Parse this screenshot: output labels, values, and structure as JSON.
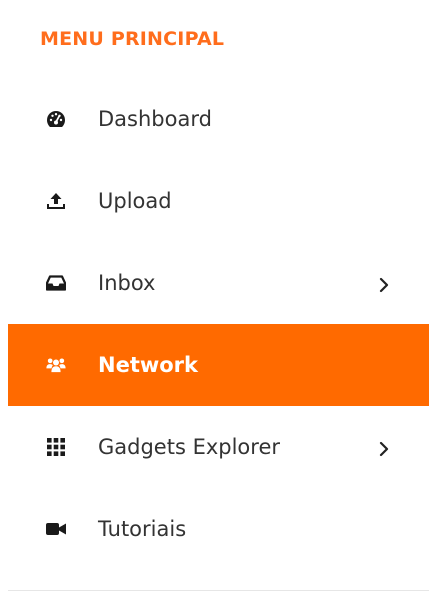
{
  "menu": {
    "title": "MENU PRINCIPAL",
    "active_color": "#ff6a00",
    "title_color": "#ff6d1c",
    "items": [
      {
        "label": "Dashboard",
        "icon": "dashboard-icon",
        "has_submenu": false,
        "active": false
      },
      {
        "label": "Upload",
        "icon": "upload-icon",
        "has_submenu": false,
        "active": false
      },
      {
        "label": "Inbox",
        "icon": "inbox-icon",
        "has_submenu": true,
        "active": false
      },
      {
        "label": "Network",
        "icon": "users-icon",
        "has_submenu": false,
        "active": true
      },
      {
        "label": "Gadgets Explorer",
        "icon": "grid-icon",
        "has_submenu": true,
        "active": false
      },
      {
        "label": "Tutoriais",
        "icon": "video-camera-icon",
        "has_submenu": false,
        "active": false
      }
    ]
  }
}
